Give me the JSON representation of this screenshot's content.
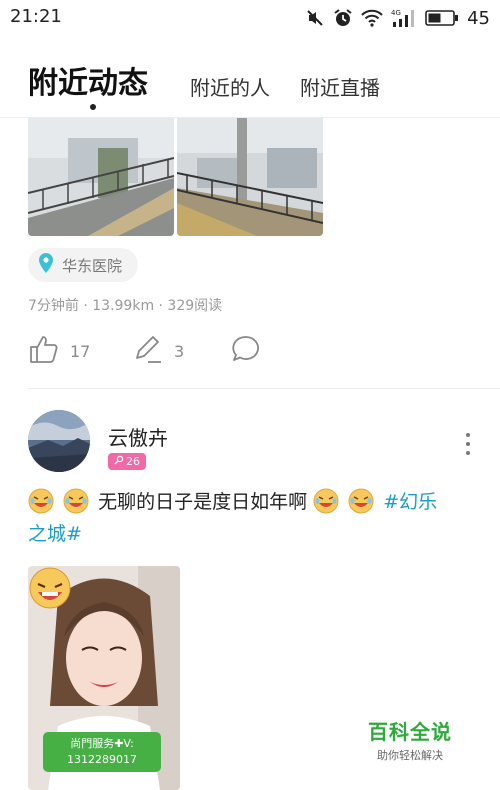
{
  "status_bar": {
    "time": "21:21",
    "battery": "45",
    "network": "4G",
    "icons": [
      "mute-icon",
      "alarm-icon",
      "wifi-icon",
      "signal-icon",
      "battery-icon"
    ]
  },
  "tabs": {
    "active": "附近动态",
    "items": [
      "附近的人",
      "附近直播"
    ]
  },
  "post1": {
    "location": "华东医院",
    "meta": "7分钟前 · 13.99km · 329阅读",
    "likes": "17",
    "comments": "3"
  },
  "post2": {
    "username": "云傲卉",
    "badge": "26",
    "text": "无聊的日子是度日如年啊",
    "hashtag_line1": "#幻乐",
    "hashtag_line2": "之城#",
    "image_caption_line1": "尚門服务✚V:",
    "image_caption_line2": "1312289017"
  },
  "watermark": {
    "title": "百科全说",
    "subtitle": "助你轻松解决"
  },
  "colors": {
    "accent_tag": "#1a9ec5",
    "badge_pink": "#f06aa8",
    "watermark_green": "#2eaa3a",
    "location_icon": "#39c2d6"
  }
}
